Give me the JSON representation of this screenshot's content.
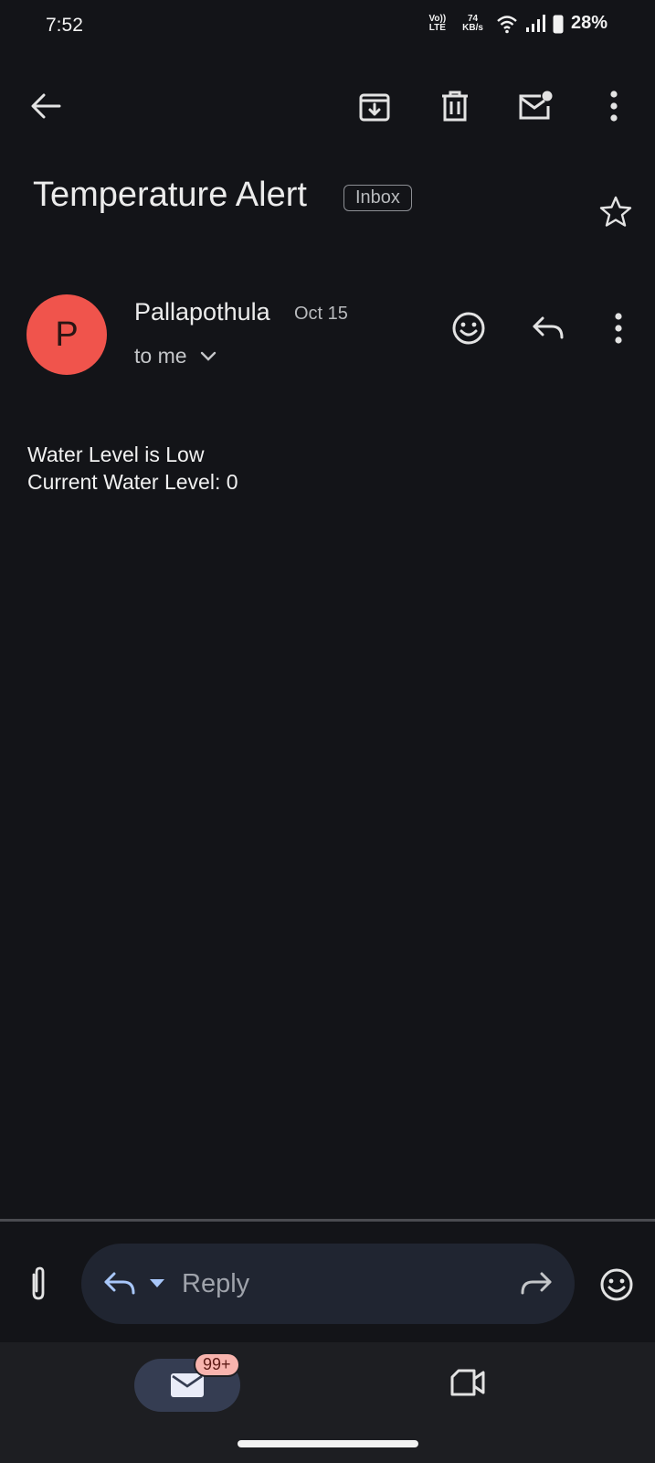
{
  "status_bar": {
    "time": "7:52",
    "volte_top": "Vo))",
    "volte_bottom": "LTE",
    "speed_value": "74",
    "speed_unit": "KB/s",
    "battery_percent": "28%"
  },
  "toolbar": {
    "back_icon": "arrow-left",
    "archive_icon": "archive",
    "delete_icon": "trash",
    "mark_unread_icon": "mail-dot",
    "more_icon": "more-vert"
  },
  "email": {
    "subject": "Temperature Alert",
    "label": "Inbox",
    "sender_initial": "P",
    "sender_name": "Pallapothula",
    "date": "Oct 15",
    "recipient": "to me",
    "body_lines": [
      "Water Level is Low",
      "Current Water Level: 0"
    ]
  },
  "reply_bar": {
    "placeholder": "Reply"
  },
  "bottom_nav": {
    "mail_badge": "99+"
  },
  "colors": {
    "background": "#131418",
    "avatar": "#f0544c",
    "reply_icon": "#a8c7fa",
    "badge": "#f8b4ae"
  }
}
